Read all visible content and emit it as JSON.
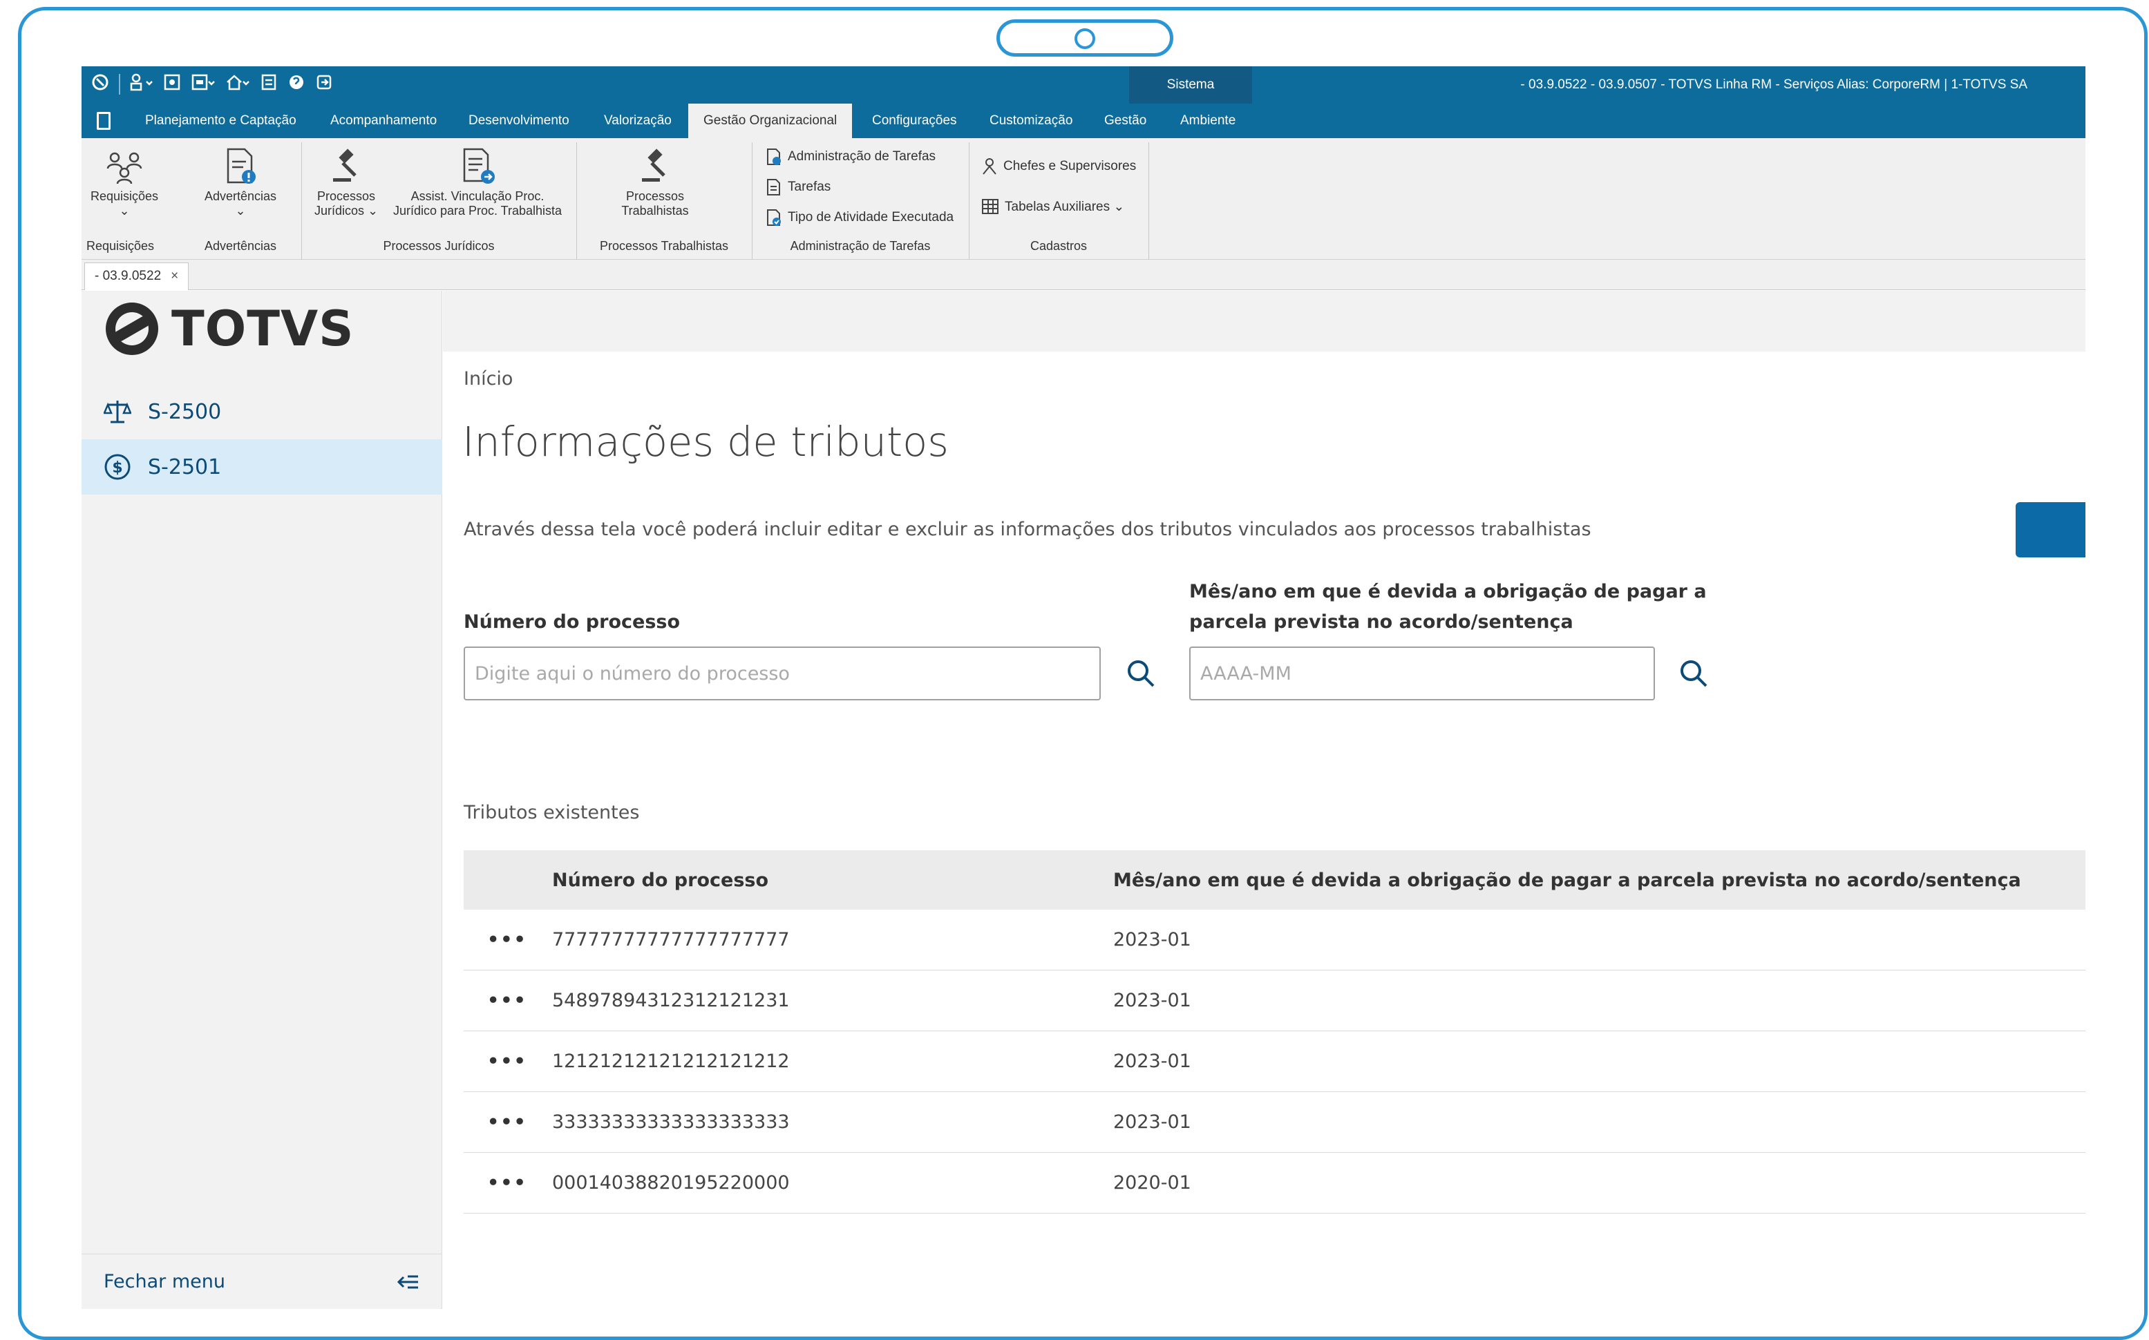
{
  "titlebar": {
    "system_label": "Sistema",
    "info": "- 03.9.0522 - 03.9.0507 - TOTVS Linha RM - Serviços  Alias: CorporeRM | 1-TOTVS SA"
  },
  "menu": {
    "tabs": [
      "Planejamento e Captação",
      "Acompanhamento",
      "Desenvolvimento",
      "Valorização",
      "Gestão Organizacional",
      "Configurações",
      "Customização",
      "Gestão",
      "Ambiente"
    ],
    "active": "Gestão Organizacional"
  },
  "ribbon": {
    "requisicoes": "Requisições",
    "advertencias": "Advertências",
    "processos_juridicos_1": "Processos",
    "processos_juridicos_2": "Jurídicos ⌄",
    "assist_1": "Assist. Vinculação Proc.",
    "assist_2": "Jurídico para Proc. Trabalhista",
    "proc_trab_1": "Processos",
    "proc_trab_2": "Trabalhistas",
    "adm_tarefas": "Administração de Tarefas",
    "tarefas": "Tarefas",
    "tipo_atividade": "Tipo de Atividade Executada",
    "chefes": "Chefes e Supervisores",
    "tabelas": "Tabelas Auxiliares  ⌄",
    "groups": {
      "requisicoes": "Requisições",
      "advertencias": "Advertências",
      "processos_juridicos": "Processos Jurídicos",
      "processos_trabalhistas": "Processos Trabalhistas",
      "adm_tarefas": "Administração de Tarefas",
      "cadastros": "Cadastros"
    }
  },
  "doctab": {
    "label": "- 03.9.0522",
    "close": "×"
  },
  "sidebar": {
    "logo": "TOTVS",
    "items": [
      {
        "label": "S-2500",
        "icon": "scale-icon"
      },
      {
        "label": "S-2501",
        "icon": "dollar-circle-icon"
      }
    ],
    "close_menu": "Fechar menu"
  },
  "page": {
    "breadcrumb": "Início",
    "title": "Informações de tributos",
    "description": "Através dessa tela você poderá incluir editar e excluir as informações dos tributos vinculados aos processos trabalhistas"
  },
  "filters": {
    "processo_label": "Número do processo",
    "processo_placeholder": "Digite aqui o número do processo",
    "mes_label_1": "Mês/ano em que é devida a obrigação de pagar a",
    "mes_label_2": "parcela prevista no acordo/sentença",
    "mes_placeholder": "AAAA-MM"
  },
  "table": {
    "label": "Tributos existentes",
    "headers": [
      "",
      "Número do processo",
      "Mês/ano em que é devida a obrigação de pagar a parcela prevista no acordo/sentença"
    ],
    "rows": [
      {
        "actions": "•••",
        "processo": "77777777777777777777",
        "mes": "2023-01"
      },
      {
        "actions": "•••",
        "processo": "54897894312312121231",
        "mes": "2023-01"
      },
      {
        "actions": "•••",
        "processo": "12121212121212121212",
        "mes": "2023-01"
      },
      {
        "actions": "•••",
        "processo": "33333333333333333333",
        "mes": "2023-01"
      },
      {
        "actions": "•••",
        "processo": "00014038820195220000",
        "mes": "2020-01"
      }
    ]
  },
  "colors": {
    "frame": "#2b96d6",
    "titlebar": "#0d6c9b",
    "sidebar_selected": "#d7ecf8",
    "link": "#0c4a78",
    "primary_button": "#0c6aa6"
  }
}
